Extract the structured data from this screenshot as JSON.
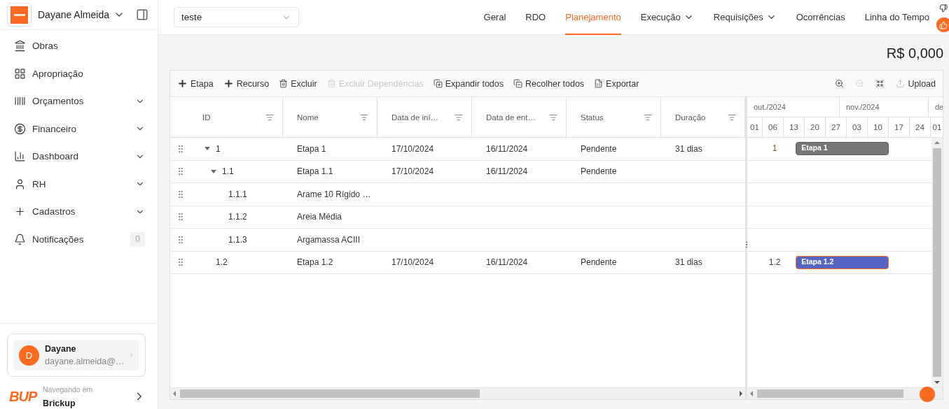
{
  "sidebar": {
    "user": "Dayane Almeida",
    "menu": [
      {
        "label": "Obras",
        "expandable": false
      },
      {
        "label": "Apropriação",
        "expandable": false
      },
      {
        "label": "Orçamentos",
        "expandable": true
      },
      {
        "label": "Financeiro",
        "expandable": true
      },
      {
        "label": "Dashboard",
        "expandable": true
      },
      {
        "label": "RH",
        "expandable": true
      },
      {
        "label": "Cadastros",
        "expandable": true
      },
      {
        "label": "Notificações",
        "expandable": false,
        "badge": "0"
      }
    ],
    "account": {
      "initial": "D",
      "name": "Dayane",
      "email": "dayane.almeida@…"
    },
    "workspace": {
      "logo": "BUP",
      "caption": "Navegando em",
      "name": "Brickup"
    }
  },
  "project_select": {
    "value": "teste"
  },
  "tabs": [
    {
      "label": "Geral",
      "selected": false,
      "has_menu": false
    },
    {
      "label": "RDO",
      "selected": false,
      "has_menu": false
    },
    {
      "label": "Planejamento",
      "selected": true,
      "has_menu": false
    },
    {
      "label": "Execução",
      "selected": false,
      "has_menu": true
    },
    {
      "label": "Requisições",
      "selected": false,
      "has_menu": true
    },
    {
      "label": "Ocorrências",
      "selected": false,
      "has_menu": false
    },
    {
      "label": "Linha do Tempo",
      "selected": false,
      "has_menu": false
    }
  ],
  "total": "R$ 0,000",
  "toolbar": [
    {
      "kind": "add",
      "label": "Etapa",
      "disabled": false
    },
    {
      "kind": "add",
      "label": "Recurso",
      "disabled": false
    },
    {
      "kind": "delete",
      "label": "Excluir",
      "disabled": false
    },
    {
      "kind": "delete",
      "label": "Excluir Dependências",
      "disabled": true
    },
    {
      "kind": "expand-all",
      "label": "Expandir todos",
      "disabled": false
    },
    {
      "kind": "collapse-all",
      "label": "Recolher todos",
      "disabled": false
    },
    {
      "kind": "export",
      "label": "Exportar",
      "disabled": false
    }
  ],
  "gantt_tools": [
    {
      "kind": "zoom-in",
      "disabled": false
    },
    {
      "kind": "zoom-out",
      "disabled": true
    },
    {
      "kind": "fit",
      "disabled": false
    },
    {
      "kind": "upload",
      "label": "Upload",
      "disabled": false
    }
  ],
  "table": {
    "columns": [
      "ID",
      "Nome",
      "Data de iní…",
      "Data de ent…",
      "Status",
      "Duração"
    ],
    "rows": [
      {
        "id": "1",
        "name": "Etapa 1",
        "start": "17/10/2024",
        "end": "16/11/2024",
        "status": "Pendente",
        "duration": "31 dias",
        "expanded": true,
        "bar": {
          "caption": "1",
          "label": "Etapa 1",
          "kind": "summary"
        },
        "children": [
          {
            "id": "1.1",
            "name": "Etapa 1.1",
            "start": "17/10/2024",
            "end": "16/11/2024",
            "status": "Pendente",
            "expanded": true,
            "children": [
              {
                "id": "1.1.1",
                "name": "Arame 10 Rígido …"
              },
              {
                "id": "1.1.2",
                "name": "Areia Média"
              },
              {
                "id": "1.1.3",
                "name": "Argamassa ACIII"
              }
            ]
          }
        ]
      },
      {
        "id": "1.2",
        "name": "Etapa 1.2",
        "start": "17/10/2024",
        "end": "16/11/2024",
        "status": "Pendente",
        "duration": "31 dias",
        "bar": {
          "caption": "1.2",
          "label": "Etapa 1.2",
          "kind": "task"
        }
      }
    ]
  },
  "gantt": {
    "months": [
      "out./2024",
      "nov./2024",
      "de"
    ],
    "days": [
      "01",
      "06",
      "13",
      "20",
      "27",
      "03",
      "10",
      "17",
      "24",
      "01"
    ]
  }
}
